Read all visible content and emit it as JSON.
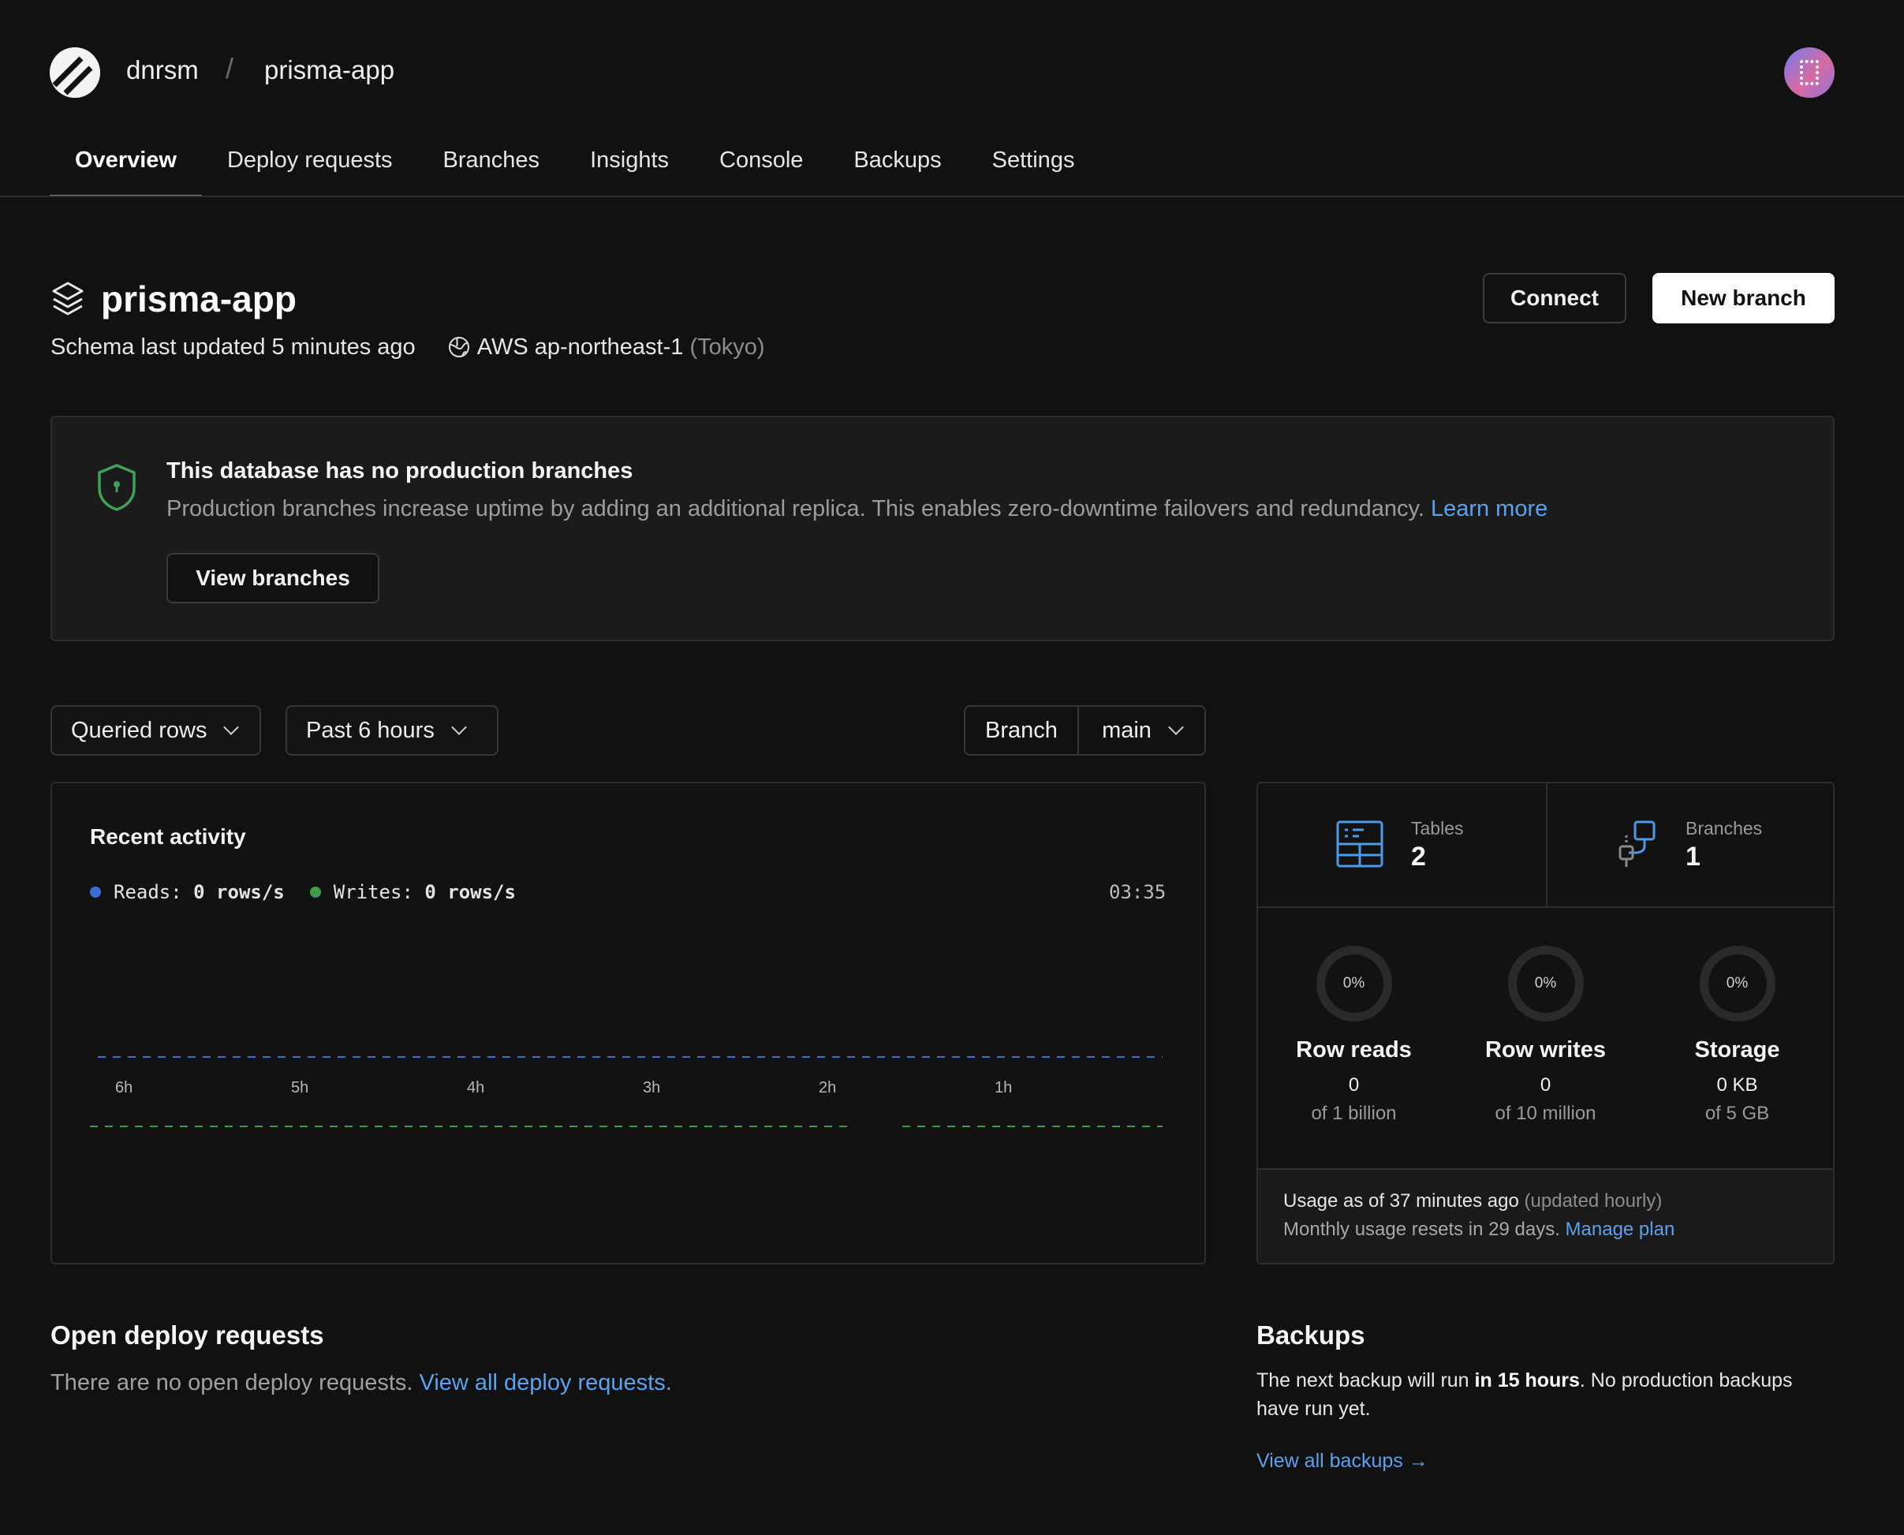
{
  "header": {
    "org": "dnrsm",
    "separator": "/",
    "project": "prisma-app"
  },
  "nav": {
    "tabs": [
      {
        "label": "Overview",
        "active": true
      },
      {
        "label": "Deploy requests"
      },
      {
        "label": "Branches"
      },
      {
        "label": "Insights"
      },
      {
        "label": "Console"
      },
      {
        "label": "Backups"
      },
      {
        "label": "Settings"
      }
    ]
  },
  "database": {
    "title": "prisma-app",
    "schema_updated": "Schema last updated 5 minutes ago",
    "region": "AWS ap-northeast-1",
    "region_city": "(Tokyo)",
    "connect_label": "Connect",
    "new_branch_label": "New branch"
  },
  "banner": {
    "title": "This database has no production branches",
    "text": "Production branches increase uptime by adding an additional replica. This enables zero-downtime failovers and redundancy.",
    "learn_more": "Learn more",
    "button": "View branches"
  },
  "filters": {
    "metric": "Queried rows",
    "range": "Past 6 hours",
    "branch_label": "Branch",
    "branch_value": "main"
  },
  "activity": {
    "title": "Recent activity",
    "reads_label": "Reads:",
    "reads_value": "0 rows/s",
    "writes_label": "Writes:",
    "writes_value": "0 rows/s",
    "time": "03:35",
    "x_ticks": [
      "6h",
      "5h",
      "4h",
      "3h",
      "2h",
      "1h"
    ],
    "colors": {
      "reads": "#3b6fd8",
      "writes": "#3f9a4a"
    }
  },
  "stats": {
    "tables_label": "Tables",
    "tables_value": "2",
    "branches_label": "Branches",
    "branches_value": "1",
    "usage": [
      {
        "pct": "0%",
        "label": "Row reads",
        "value": "0",
        "of": "of 1 billion"
      },
      {
        "pct": "0%",
        "label": "Row writes",
        "value": "0",
        "of": "of 10 million"
      },
      {
        "pct": "0%",
        "label": "Storage",
        "value": "0 KB",
        "of": "of 5 GB"
      }
    ],
    "usage_as_of": "Usage as of 37 minutes ago",
    "usage_updated": "(updated hourly)",
    "reset_text": "Monthly usage resets in 29 days.",
    "manage_plan": "Manage plan"
  },
  "deploy": {
    "title": "Open deploy requests",
    "text": "There are no open deploy requests.",
    "link": "View all deploy requests."
  },
  "backups": {
    "title": "Backups",
    "text_pre": "The next backup will run ",
    "text_bold": "in 15 hours",
    "text_post": ". No production backups have run yet.",
    "link": "View all backups →"
  }
}
